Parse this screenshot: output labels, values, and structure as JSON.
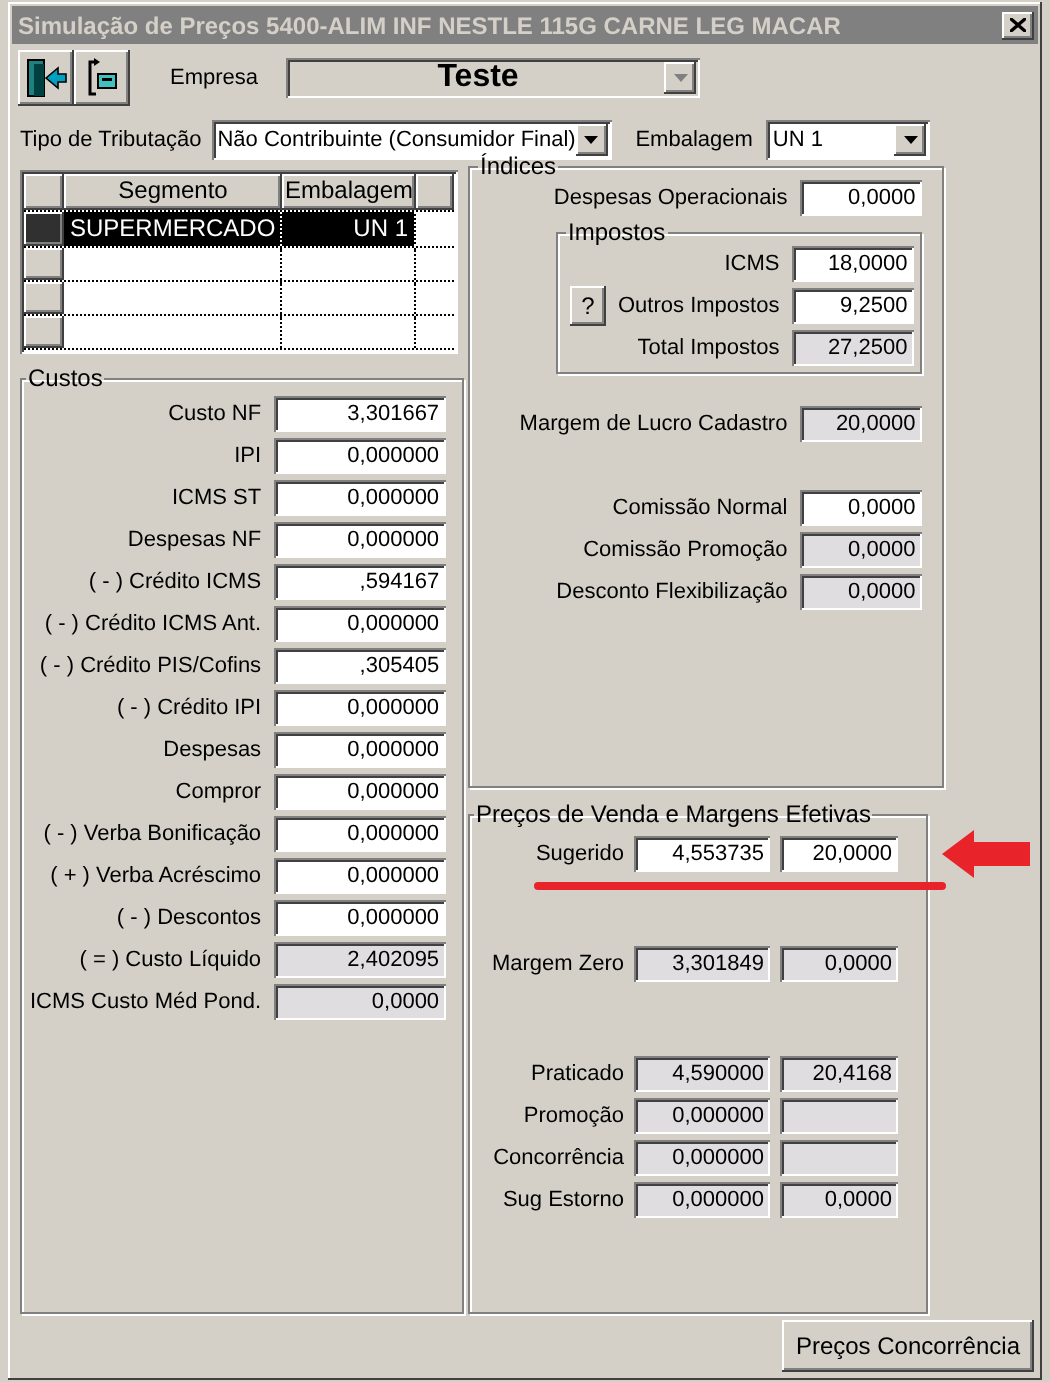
{
  "window": {
    "title": "Simulação de Preços  5400-ALIM INF NESTLE 115G CARNE LEG MACAR"
  },
  "toolbar": [
    {
      "kind": "exit"
    },
    {
      "kind": "swap"
    }
  ],
  "empresa": {
    "label": "Empresa",
    "value": "Teste",
    "disabled": true
  },
  "tributacao": {
    "label": "Tipo de Tributação",
    "value": "Não Contribuinte (Consumidor Final)"
  },
  "embalagem": {
    "label": "Embalagem",
    "value": "UN  1"
  },
  "grid": {
    "columns": [
      "Segmento",
      "Embalagem"
    ],
    "rows": [
      {
        "segmento": "SUPERMERCADO",
        "embalagem": "UN  1",
        "selected": true
      }
    ]
  },
  "custos": {
    "title": "Custos",
    "fields": [
      {
        "label": "Custo NF",
        "value": "3,301667",
        "disabled": false
      },
      {
        "label": "IPI",
        "value": "0,000000",
        "disabled": false
      },
      {
        "label": "ICMS ST",
        "value": "0,000000",
        "disabled": false
      },
      {
        "label": "Despesas NF",
        "value": "0,000000",
        "disabled": false
      },
      {
        "label": "( - ) Crédito ICMS",
        "value": ",594167",
        "disabled": false
      },
      {
        "label": "( - ) Crédito ICMS Ant.",
        "value": "0,000000",
        "disabled": false
      },
      {
        "label": "( - ) Crédito PIS/Cofins",
        "value": ",305405",
        "disabled": false
      },
      {
        "label": "( - ) Crédito IPI",
        "value": "0,000000",
        "disabled": false
      },
      {
        "label": "Despesas",
        "value": "0,000000",
        "disabled": false
      },
      {
        "label": "Compror",
        "value": "0,000000",
        "disabled": false
      },
      {
        "label": "( - ) Verba Bonificação",
        "value": "0,000000",
        "disabled": false
      },
      {
        "label": "( + ) Verba Acréscimo",
        "value": "0,000000",
        "disabled": false
      },
      {
        "label": "( - ) Descontos",
        "value": "0,000000",
        "disabled": false
      },
      {
        "label": "( = ) Custo Líquido",
        "value": "2,402095",
        "disabled": true
      },
      {
        "label": "ICMS Custo Méd Pond.",
        "value": "0,0000",
        "disabled": true
      }
    ]
  },
  "indices": {
    "title": "Índices",
    "top": {
      "label": "Despesas Operacionais",
      "value": "0,0000",
      "disabled": false
    },
    "impostos": {
      "title": "Impostos",
      "help_button": "?",
      "fields": [
        {
          "label": "ICMS",
          "value": "18,0000",
          "disabled": false
        },
        {
          "label": "Outros Impostos",
          "value": "9,2500",
          "disabled": false
        },
        {
          "label": "Total Impostos",
          "value": "27,2500",
          "disabled": true
        }
      ]
    },
    "groups": [
      [
        {
          "label": "Margem de Lucro Cadastro",
          "value": "20,0000",
          "disabled": true
        }
      ],
      [
        {
          "label": "Comissão Normal",
          "value": "0,0000",
          "disabled": false
        },
        {
          "label": "Comissão Promoção",
          "value": "0,0000",
          "disabled": true
        },
        {
          "label": "Desconto Flexibilização",
          "value": "0,0000",
          "disabled": true
        }
      ]
    ]
  },
  "precos": {
    "title": "Preços de Venda e Margens Efetivas",
    "groups": [
      [
        {
          "label": "Sugerido",
          "price": {
            "value": "4,553735",
            "disabled": false
          },
          "margin": {
            "value": "20,0000",
            "disabled": false
          },
          "highlighted": true
        }
      ],
      [
        {
          "label": "Margem Zero",
          "price": {
            "value": "3,301849",
            "disabled": true
          },
          "margin": {
            "value": "0,0000",
            "disabled": true
          },
          "highlighted": false
        }
      ],
      [
        {
          "label": "Praticado",
          "price": {
            "value": "4,590000",
            "disabled": true
          },
          "margin": {
            "value": "20,4168",
            "disabled": true
          },
          "highlighted": false
        },
        {
          "label": "Promoção",
          "price": {
            "value": "0,000000",
            "disabled": true
          },
          "margin": {
            "disabled": true
          },
          "highlighted": false
        },
        {
          "label": "Concorrência",
          "price": {
            "value": "0,000000",
            "disabled": true
          },
          "margin": {
            "disabled": true
          },
          "highlighted": false
        },
        {
          "label": "Sug Estorno",
          "price": {
            "value": "0,000000",
            "disabled": true
          },
          "margin": {
            "value": "0,0000",
            "disabled": true
          },
          "highlighted": false
        }
      ]
    ]
  },
  "bottom_button": "Preços Concorrência"
}
